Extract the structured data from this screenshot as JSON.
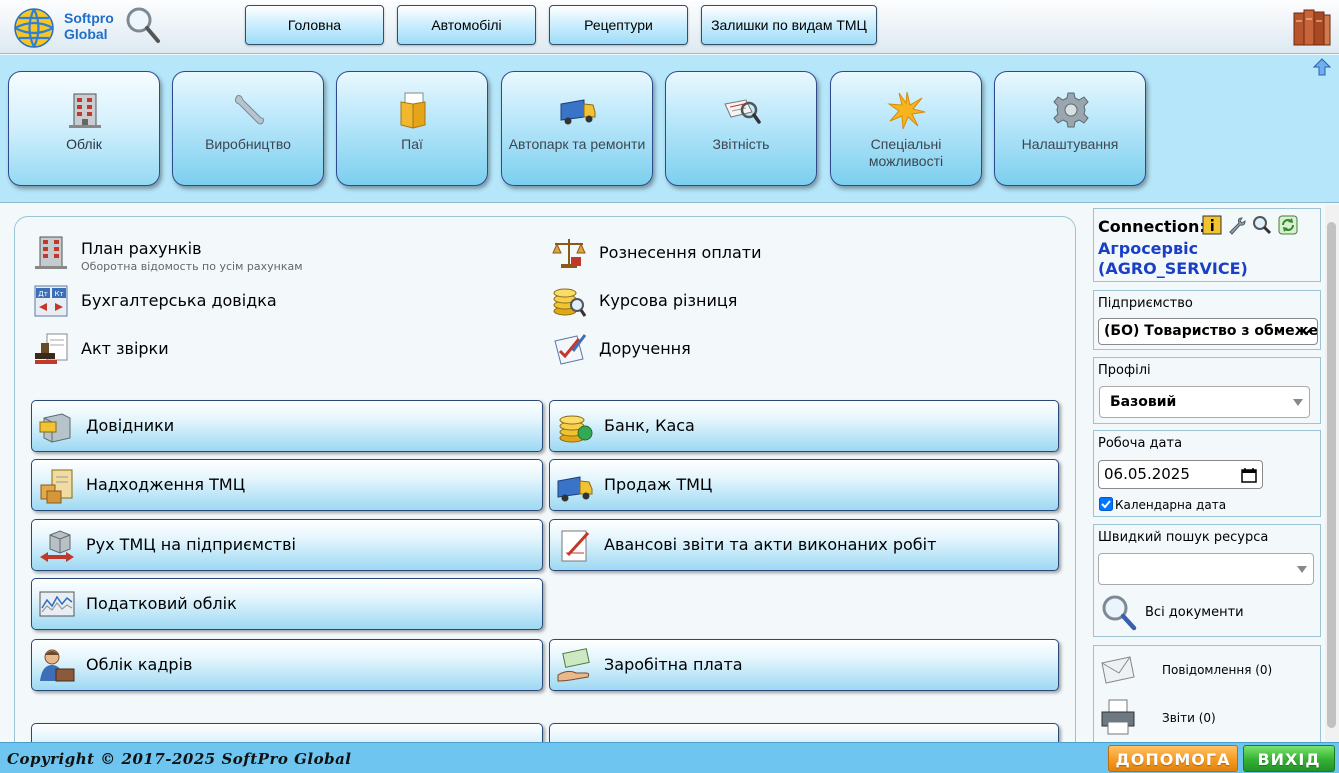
{
  "logo": {
    "line1": "Softpro",
    "line2": "Global"
  },
  "top_nav": [
    "Головна",
    "Автомобілі",
    "Рецептури",
    "Залишки по видам ТМЦ"
  ],
  "ribbon": [
    {
      "label": "Облік",
      "icon": "building-icon",
      "active": true
    },
    {
      "label": "Виробництво",
      "icon": "wrench-icon"
    },
    {
      "label": "Паї",
      "icon": "folder-document-icon"
    },
    {
      "label": "Автопарк та ремонти",
      "icon": "truck-icon"
    },
    {
      "label": "Звітність",
      "icon": "report-magnifier-icon"
    },
    {
      "label": "Спеціальні можливості",
      "icon": "sparkle-icon"
    },
    {
      "label": "Налаштування",
      "icon": "gear-icon"
    }
  ],
  "quick_links": [
    {
      "title": "План рахунків",
      "subtitle": "Оборотна відомость по усім рахункам",
      "icon": "ledger-building-icon"
    },
    {
      "title": "Рознесення оплати",
      "icon": "scales-icon"
    },
    {
      "title": "Бухгалтерська довідка",
      "icon": "debit-credit-icon"
    },
    {
      "title": "Курсова різниця",
      "icon": "coins-magnifier-icon"
    },
    {
      "title": "Акт звірки",
      "icon": "stamp-icon"
    },
    {
      "title": "Доручення",
      "icon": "checklist-icon"
    }
  ],
  "sections": [
    {
      "label": "Довідники",
      "icon": "cabinet-icon"
    },
    {
      "label": "Банк, Каса",
      "icon": "coins-icon"
    },
    {
      "label": "Надходження ТМЦ",
      "icon": "clipboard-boxes-icon"
    },
    {
      "label": "Продаж ТМЦ",
      "icon": "delivery-truck-icon"
    },
    {
      "label": "Рух ТМЦ на підприємстві",
      "icon": "box-arrows-icon"
    },
    {
      "label": "Авансові звіти та акти виконаних робіт",
      "icon": "pen-document-icon"
    },
    {
      "label": "Податковий облік",
      "icon": "chart-monitor-icon"
    },
    {
      "label": "Облік кадрів",
      "icon": "worker-icon"
    },
    {
      "label": "Заробітна плата",
      "icon": "money-hand-icon"
    }
  ],
  "side": {
    "connection_label": "Connection:",
    "connection_name": "Агросервіс (AGRO_SERVICE)",
    "enterprise_label": "Підприємство",
    "enterprise_value": "(БО) Товариство з обмеже",
    "profiles_label": "Профілі",
    "profile_value": "Базовий",
    "work_date_label": "Робоча дата",
    "work_date_value": "06.05.2025",
    "calendar_date_label": "Календарна дата",
    "calendar_checked": true,
    "quick_search_label": "Швидкий пошук ресурса",
    "all_documents_label": "Всі документи",
    "messages_label": "Повідомлення (0)",
    "reports_label": "Звіти (0)"
  },
  "footer": {
    "copyright": "Copyright © 2017-2025 SoftPro Global",
    "help_label": "ДОПОМОГА",
    "exit_label": "ВИХІД"
  },
  "colors": {
    "ribbon_bg": "#b6e6fa",
    "accent_blue": "#1a3fc4",
    "footer_bg": "#6ec6f0",
    "help_button": "#f59a23",
    "exit_button": "#34b233"
  }
}
